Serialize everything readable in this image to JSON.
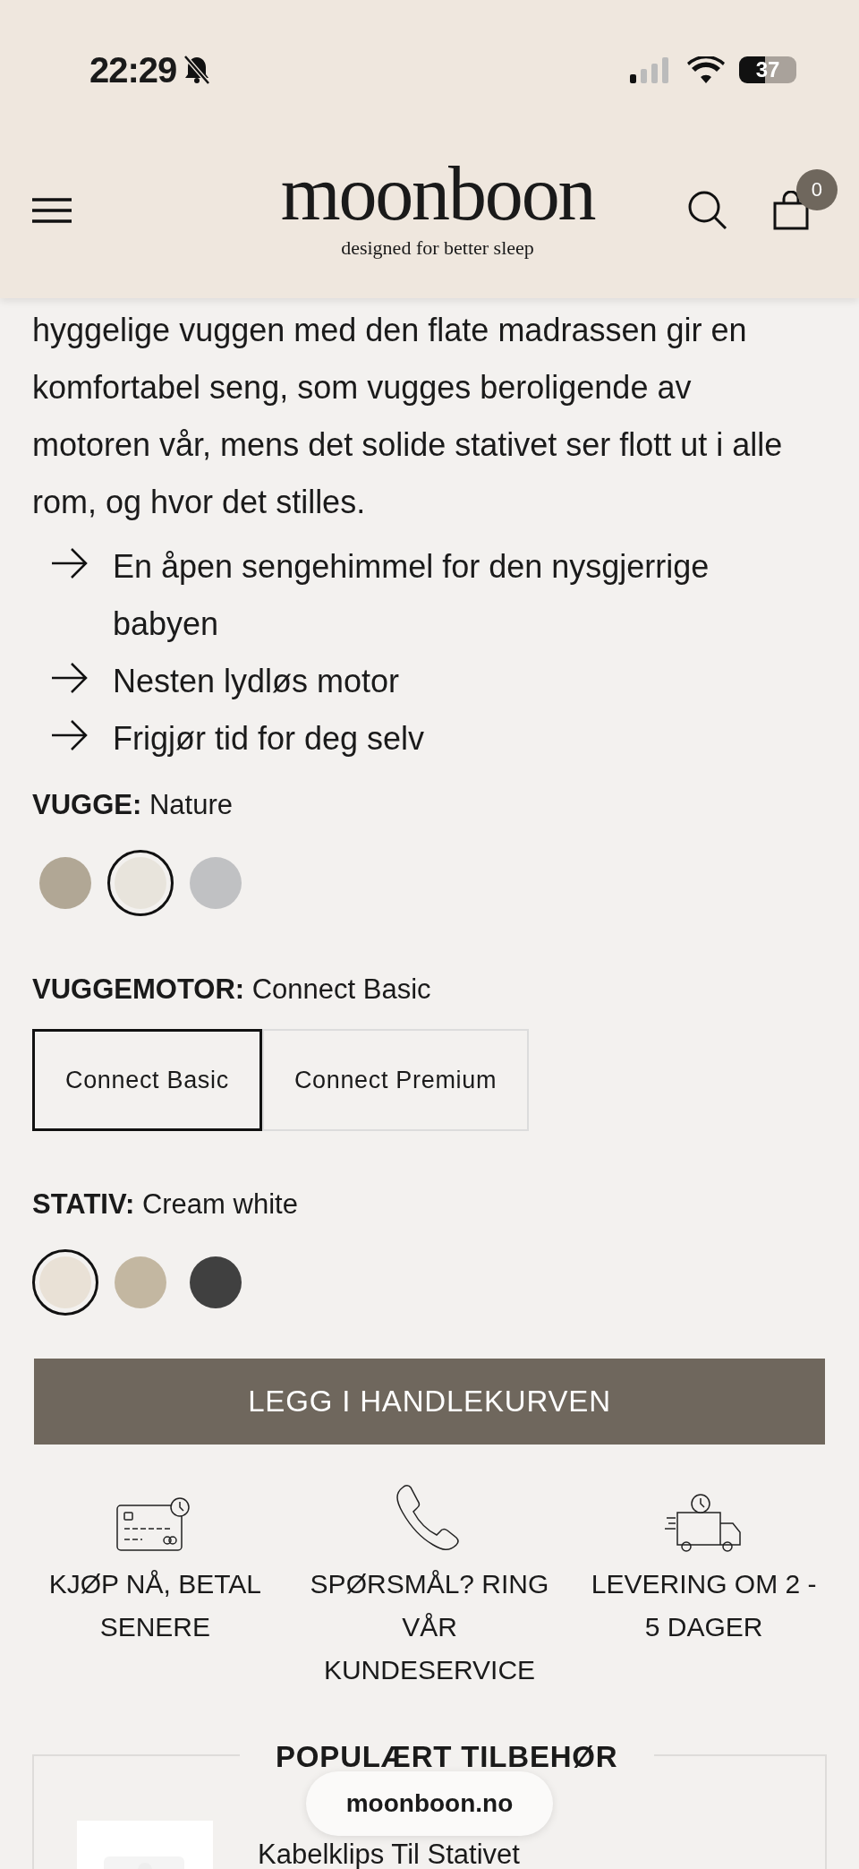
{
  "status_bar": {
    "time": "22:29",
    "silent": true,
    "battery": "37"
  },
  "header": {
    "logo": "moonboon",
    "tagline": "designed for better sleep",
    "cart_count": "0"
  },
  "description": [
    "hyggelige vuggen med den flate madrassen gir en",
    "komfortabel seng, som vugges beroligende av",
    "motoren vår, mens det solide stativet ser flott ut i alle",
    "rom, og hvor det stilles."
  ],
  "features": [
    "En åpen sengehimmel for den nysgjerrige babyen",
    "Nesten lydløs motor",
    "Frigjør tid for deg selv"
  ],
  "options": [
    {
      "kind": "swatch",
      "label": "VUGGE:",
      "value": "Nature",
      "choices": [
        {
          "color": "#b1a795",
          "selected": false
        },
        {
          "color": "#e8e4dc",
          "selected": true
        },
        {
          "color": "#c0c1c3",
          "selected": false
        }
      ]
    },
    {
      "kind": "button",
      "label": "VUGGEMOTOR:",
      "value": "Connect Basic",
      "choices": [
        {
          "text": "Connect Basic",
          "selected": true
        },
        {
          "text": "Connect Premium",
          "selected": false
        }
      ]
    },
    {
      "kind": "swatch",
      "label": "STATIV:",
      "value": "Cream white",
      "choices": [
        {
          "color": "#e9e1d6",
          "selected": true
        },
        {
          "color": "#c3b7a1",
          "selected": false
        },
        {
          "color": "#404040",
          "selected": false
        }
      ]
    }
  ],
  "add_to_cart": "LEGG I HANDLEKURVEN",
  "perks": [
    {
      "kind": "card",
      "text": "KJØP NÅ, BETAL SENERE"
    },
    {
      "kind": "phone",
      "text": "SPØRSMÅL? RING VÅR KUNDESERVICE"
    },
    {
      "kind": "truck",
      "text": "LEVERING OM 2 - 5 DAGER"
    }
  ],
  "accessories": {
    "title": "POPULÆRT TILBEHØR",
    "items": [
      {
        "name": "Kabelklips Til Stativet"
      }
    ]
  },
  "url_bar": "moonboon.no"
}
